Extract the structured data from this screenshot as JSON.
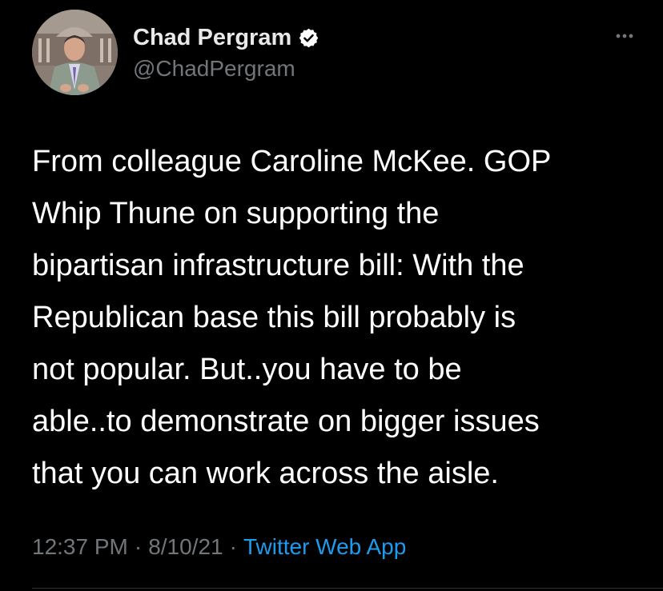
{
  "author": {
    "display_name": "Chad Pergram",
    "handle": "@ChadPergram",
    "verified": true
  },
  "tweet": {
    "text": "From colleague Caroline McKee. GOP\nWhip Thune on supporting the\nbipartisan infrastructure bill: With the\nRepublican base this bill probably is\nnot popular. But..you have to be\nable..to demonstrate on bigger issues\nthat you can work across the aisle.",
    "time": "12:37 PM",
    "date": "8/10/21",
    "source": "Twitter Web App"
  },
  "colors": {
    "background": "#000000",
    "text": "#ffffff",
    "secondary": "#71767b",
    "accent": "#1d9bf0"
  },
  "icons": {
    "verified": "verified-badge-icon",
    "more": "more-options-icon"
  }
}
